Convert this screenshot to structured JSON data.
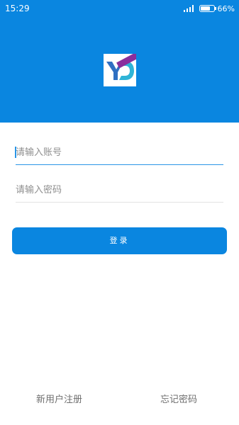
{
  "status_bar": {
    "time": "15:29",
    "battery_percent": "66%",
    "icons": [
      "signal-icon",
      "battery-icon"
    ]
  },
  "colors": {
    "brand_blue": "#0a86e0",
    "input_focus_blue": "#2a95e6",
    "logo_ribbon_purple": "#8a2f9c"
  },
  "login": {
    "account_placeholder": "请输入账号",
    "password_placeholder": "请输入密码",
    "login_label": "登录"
  },
  "footer": {
    "register_label": "新用户注册",
    "forgot_label": "忘记密码"
  }
}
